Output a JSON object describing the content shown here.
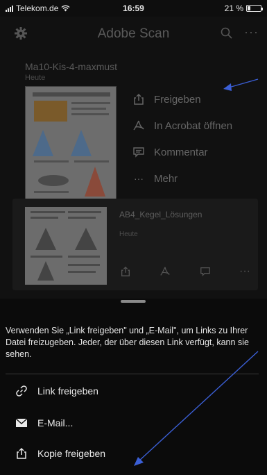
{
  "status_bar": {
    "carrier": "Telekom.de",
    "time": "16:59",
    "battery": "21 %",
    "battery_level": 0.21
  },
  "header": {
    "title": "Adobe Scan"
  },
  "document1": {
    "name": "Ma10-Kis-4-maxmust",
    "date": "Heute",
    "actions": [
      {
        "label": "Freigeben",
        "icon": "share-icon"
      },
      {
        "label": "In Acrobat öffnen",
        "icon": "acrobat-icon"
      },
      {
        "label": "Kommentar",
        "icon": "comment-icon"
      },
      {
        "label": "Mehr",
        "icon": "more-icon"
      }
    ]
  },
  "document2": {
    "name": "AB4_Kegel_Lösungen",
    "date": "Heute"
  },
  "sheet": {
    "info": "Verwenden Sie „Link freigeben\" und „E-Mail\", um Links zu Ihrer Datei freizugeben. Jeder, der über diesen Link verfügt, kann sie sehen.",
    "options": [
      {
        "label": "Link freigeben",
        "icon": "link-icon"
      },
      {
        "label": "E-Mail...",
        "icon": "mail-icon"
      },
      {
        "label": "Kopie freigeben",
        "icon": "share-icon"
      }
    ]
  },
  "colors": {
    "annotation_arrow": "#3b5fd6",
    "sheet_bg": "#0b0b0b",
    "dim_bg": "#111111"
  }
}
